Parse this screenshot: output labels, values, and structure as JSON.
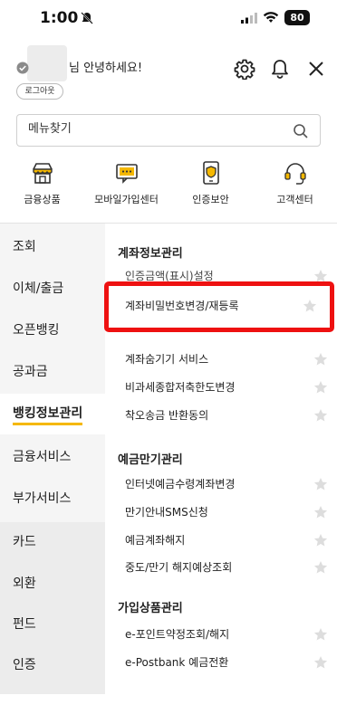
{
  "status_bar": {
    "time": "1:00",
    "battery": "80"
  },
  "header": {
    "greeting": "님 안녕하세요!",
    "logout_label": "로그아웃"
  },
  "search": {
    "placeholder": "메뉴찾기"
  },
  "quick_menu": [
    {
      "label": "금융상품",
      "icon": "store-icon"
    },
    {
      "label": "모바일가입센터",
      "icon": "chat-screen-icon"
    },
    {
      "label": "인증보안",
      "icon": "shield-icon"
    },
    {
      "label": "고객센터",
      "icon": "headset-icon"
    }
  ],
  "left_nav": [
    {
      "label": "조회"
    },
    {
      "label": "이체/출금"
    },
    {
      "label": "오픈뱅킹"
    },
    {
      "label": "공과금"
    },
    {
      "label": "뱅킹정보관리",
      "active": true
    },
    {
      "label": "금융서비스"
    },
    {
      "label": "부가서비스"
    },
    {
      "label": "카드"
    },
    {
      "label": "외환"
    },
    {
      "label": "펀드"
    },
    {
      "label": "인증"
    }
  ],
  "sections": [
    {
      "title": "계좌정보관리",
      "items": [
        "인증금액(표시)설정",
        "계좌비밀번호변경/재등록",
        "",
        "계좌숨기기 서비스",
        "비과세종합저축한도변경",
        "착오송금 반환동의"
      ]
    },
    {
      "title": "예금만기관리",
      "items": [
        "인터넷예금수령계좌변경",
        "만기안내SMS신청",
        "예금계좌해지",
        "중도/만기 해지예상조회"
      ]
    },
    {
      "title": "가입상품관리",
      "items": [
        "e-포인트약정조회/해지",
        "e-Postbank 예금전환"
      ]
    }
  ],
  "highlight": {
    "label": "계좌비밀번호변경/재등록",
    "color": "#ee1111"
  },
  "accent_color": "#f5b800"
}
